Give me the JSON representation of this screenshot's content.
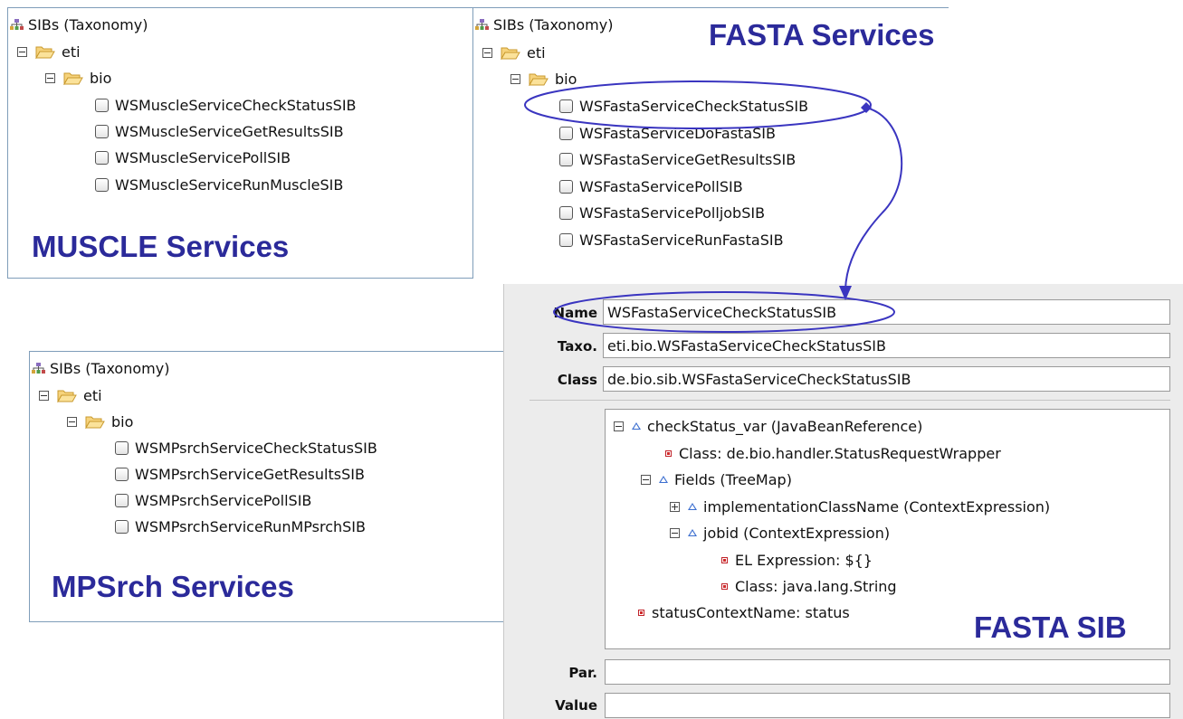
{
  "panels": {
    "muscle": {
      "title": "SIBs (Taxonomy)",
      "root": "eti",
      "child": "bio",
      "items": [
        "WSMuscleServiceCheckStatusSIB",
        "WSMuscleServiceGetResultsSIB",
        "WSMuscleServicePollSIB",
        "WSMuscleServiceRunMuscleSIB"
      ],
      "caption": "MUSCLE Services"
    },
    "fasta": {
      "title": "SIBs (Taxonomy)",
      "root": "eti",
      "child": "bio",
      "items": [
        "WSFastaServiceCheckStatusSIB",
        "WSFastaServiceDoFastaSIB",
        "WSFastaServiceGetResultsSIB",
        "WSFastaServicePollSIB",
        "WSFastaServicePolljobSIB",
        "WSFastaServiceRunFastaSIB"
      ],
      "caption": "FASTA Services"
    },
    "mpsrch": {
      "title": "SIBs (Taxonomy)",
      "root": "eti",
      "child": "bio",
      "items": [
        "WSMPsrchServiceCheckStatusSIB",
        "WSMPsrchServiceGetResultsSIB",
        "WSMPsrchServicePollSIB",
        "WSMPsrchServiceRunMPsrchSIB"
      ],
      "caption": "MPSrch Services"
    }
  },
  "properties": {
    "name_label": "Name",
    "name_value": "WSFastaServiceCheckStatusSIB",
    "taxo_label": "Taxo.",
    "taxo_value": "eti.bio.WSFastaServiceCheckStatusSIB",
    "class_label": "Class",
    "class_value": "de.bio.sib.WSFastaServiceCheckStatusSIB",
    "par_label": "Par.",
    "par_value": "",
    "value_label": "Value",
    "value_value": "",
    "tree": {
      "check_status": "checkStatus_var (JavaBeanReference)",
      "class_handler": "Class: de.bio.handler.StatusRequestWrapper",
      "fields": "Fields (TreeMap)",
      "impl_class": "implementationClassName (ContextExpression)",
      "jobid": "jobid (ContextExpression)",
      "el_expression": "EL Expression: ${}",
      "class_string": "Class: java.lang.String",
      "status_ctx": "statusContextName: status"
    },
    "caption": "FASTA SIB"
  },
  "colors": {
    "caption": "#2b2a9a",
    "annotation": "#3a35c0"
  },
  "icons": {
    "taxonomy": "taxonomy-icon",
    "folder": "folder-open-icon",
    "leaf": "sib-leaf-icon"
  }
}
